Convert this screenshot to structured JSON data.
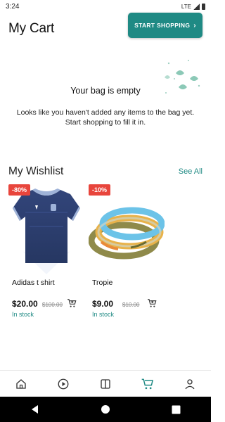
{
  "status_bar": {
    "time": "3:24",
    "network": "LTE"
  },
  "header": {
    "title": "My Cart",
    "start_shopping_label": "START SHOPPING",
    "start_shopping_icon": "chevron-right-icon"
  },
  "empty_state": {
    "title": "Your bag is empty",
    "message": "Looks like you haven't added any items to the bag yet. Start shopping to fill it in."
  },
  "wishlist": {
    "title": "My Wishlist",
    "see_all_label": "See All",
    "items": [
      {
        "badge": "-80%",
        "name": "Adidas t shirt",
        "price": "$20.00",
        "old_price": "$100.00",
        "stock": "In stock",
        "image_icon": "tshirt-image",
        "action_icon": "add-to-cart-icon"
      },
      {
        "badge": "-10%",
        "name": "Tropie",
        "price": "$9.00",
        "old_price": "$10.00",
        "stock": "In stock",
        "image_icon": "wristband-image",
        "action_icon": "add-to-cart-icon"
      }
    ]
  },
  "bottom_nav": [
    {
      "icon": "home-icon",
      "active": false
    },
    {
      "icon": "play-icon",
      "active": false
    },
    {
      "icon": "book-icon",
      "active": false
    },
    {
      "icon": "cart-icon",
      "active": true
    },
    {
      "icon": "profile-icon",
      "active": false
    }
  ],
  "colors": {
    "accent": "#1f8a84",
    "badge": "#e8453c",
    "text": "#111111"
  }
}
